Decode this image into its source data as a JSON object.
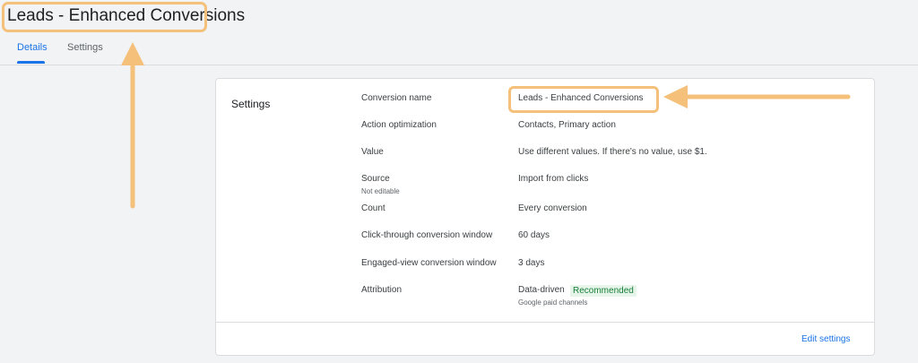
{
  "header": {
    "title": "Leads - Enhanced Conversions"
  },
  "tabs": [
    {
      "label": "Details",
      "active": true
    },
    {
      "label": "Settings",
      "active": false
    }
  ],
  "settings_card": {
    "title": "Settings",
    "rows": [
      {
        "label": "Conversion name",
        "value": "Leads - Enhanced Conversions"
      },
      {
        "label": "Action optimization",
        "value": "Contacts, Primary action"
      },
      {
        "label": "Value",
        "value": "Use different values. If there's no value, use $1."
      },
      {
        "label": "Source",
        "sublabel": "Not editable",
        "value": "Import from clicks"
      },
      {
        "label": "Count",
        "value": "Every conversion"
      },
      {
        "label": "Click-through conversion window",
        "value": "60 days"
      },
      {
        "label": "Engaged-view conversion window",
        "value": "3 days"
      },
      {
        "label": "Attribution",
        "value": "Data-driven",
        "badge": "Recommended",
        "value_sub": "Google paid channels"
      }
    ],
    "edit_label": "Edit settings"
  },
  "colors": {
    "accent": "#1a73e8",
    "highlight": "#f4c07a",
    "recommended_text": "#188038",
    "recommended_bg": "#e6f4ea"
  }
}
